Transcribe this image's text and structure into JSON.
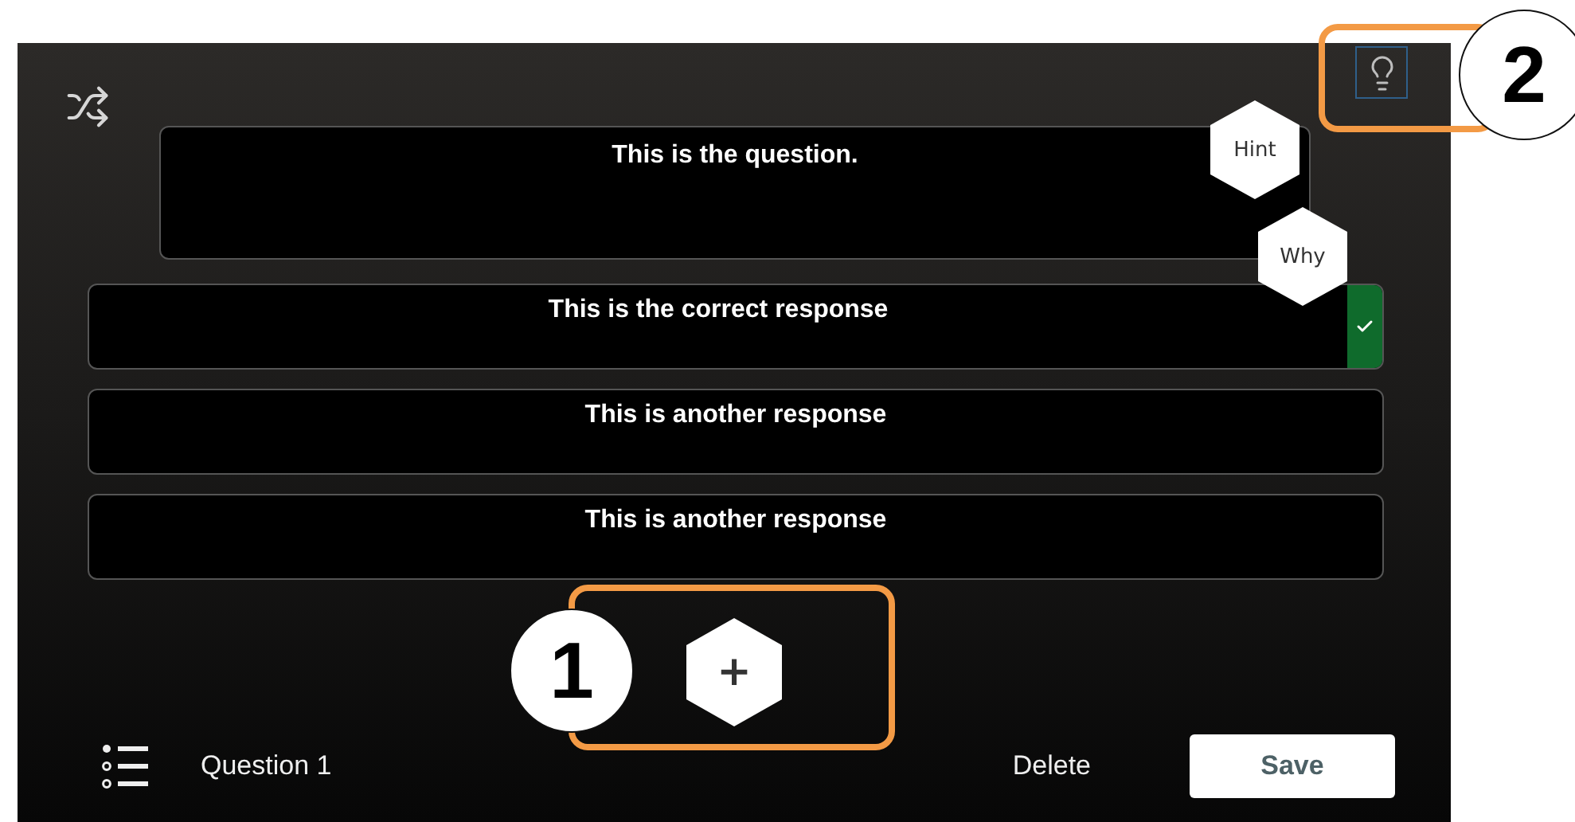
{
  "question": {
    "text": "This is the question."
  },
  "hint_buttons": [
    {
      "label": "Hint"
    },
    {
      "label": "Why"
    }
  ],
  "responses": [
    {
      "text": "This is the correct response",
      "correct": true
    },
    {
      "text": "This is another response",
      "correct": false
    },
    {
      "text": "This is another response",
      "correct": false
    }
  ],
  "add_button": {
    "label": "+"
  },
  "footer": {
    "question_label": "Question 1",
    "delete": "Delete",
    "save": "Save"
  },
  "callouts": [
    {
      "number": "1"
    },
    {
      "number": "2"
    }
  ]
}
